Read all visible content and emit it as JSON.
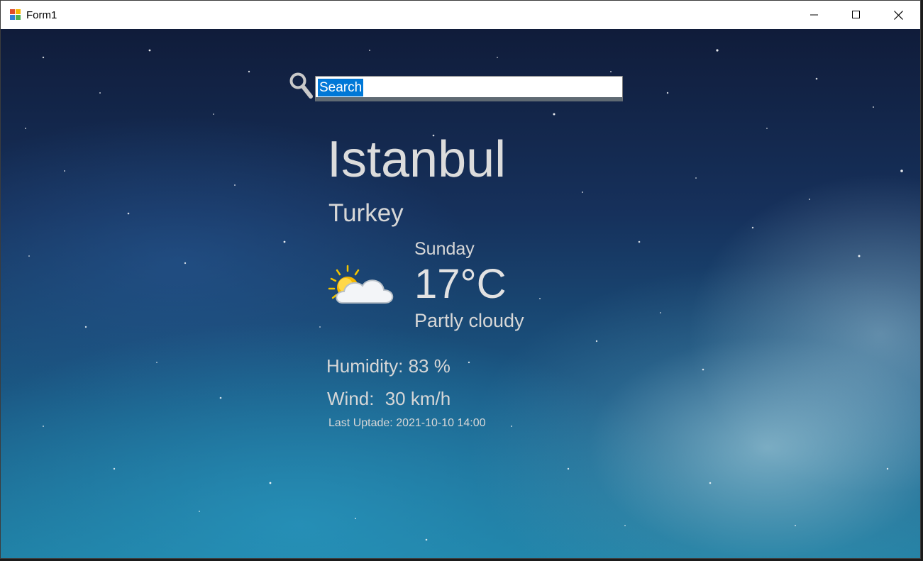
{
  "window": {
    "title": "Form1"
  },
  "search": {
    "value": "Search",
    "icon": "search-icon"
  },
  "location": {
    "city": "Istanbul",
    "country": "Turkey"
  },
  "weather": {
    "day": "Sunday",
    "temperature": "17°C",
    "condition": "Partly cloudy",
    "icon": "partly-cloudy-icon",
    "humidity_label": "Humidity:",
    "humidity_value": "83 %",
    "wind_label": "Wind:",
    "wind_value": "30 km/h",
    "last_update_label": "Last Uptade:",
    "last_update_value": "2021-10-10 14:00"
  },
  "colors": {
    "selection": "#0078d7",
    "text": "#d7d7d7"
  }
}
